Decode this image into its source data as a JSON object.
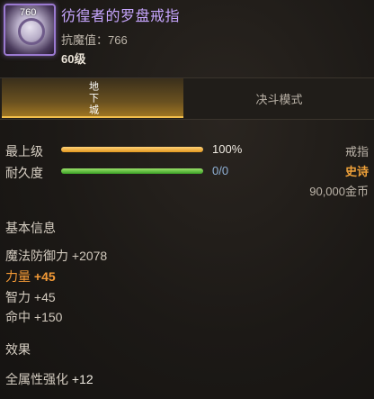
{
  "item": {
    "name": "彷徨者的罗盘戒指",
    "icon_badge": "760",
    "icon_name": "compass-ring-icon",
    "resist_label": "抗魔值：766",
    "level_label": "60级"
  },
  "tabs": [
    {
      "label": "地下城",
      "active": true
    },
    {
      "label": "决斗模式",
      "active": false
    }
  ],
  "stats": {
    "top_level": {
      "label": "最上级",
      "value_text": "100%",
      "fraction": 1.0
    },
    "durability": {
      "label": "耐久度",
      "value_text": "0/0",
      "fraction": 1.0
    }
  },
  "meta": {
    "slot": "戒指",
    "rarity": "史诗",
    "price": "90,000金币"
  },
  "sections": {
    "basic": {
      "title": "基本信息",
      "attrs": [
        {
          "label": "魔法防御力",
          "value": "+2078",
          "highlight": false
        },
        {
          "label": "力量",
          "value": "+45",
          "highlight": true
        },
        {
          "label": "智力",
          "value": "+45",
          "highlight": false
        },
        {
          "label": "命中",
          "value": "+150",
          "highlight": false
        }
      ]
    },
    "effects": {
      "title": "效果",
      "attrs": [
        {
          "label": "全属性强化",
          "value": "+12",
          "highlight": false
        }
      ]
    }
  },
  "colors": {
    "title_purple": "#c7a6ff",
    "epic_orange": "#f0a23a",
    "highlight_orange": "#f39a36",
    "tab_active_gold": "#a57a22"
  }
}
